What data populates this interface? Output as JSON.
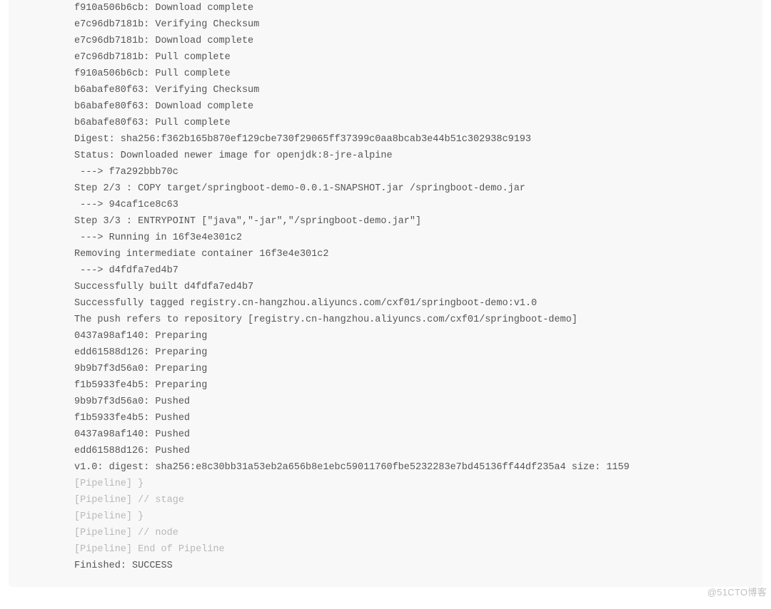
{
  "console": {
    "lines": [
      {
        "text": "f910a506b6cb: Download complete",
        "muted": false
      },
      {
        "text": "e7c96db7181b: Verifying Checksum",
        "muted": false
      },
      {
        "text": "e7c96db7181b: Download complete",
        "muted": false
      },
      {
        "text": "e7c96db7181b: Pull complete",
        "muted": false
      },
      {
        "text": "f910a506b6cb: Pull complete",
        "muted": false
      },
      {
        "text": "b6abafe80f63: Verifying Checksum",
        "muted": false
      },
      {
        "text": "b6abafe80f63: Download complete",
        "muted": false
      },
      {
        "text": "b6abafe80f63: Pull complete",
        "muted": false
      },
      {
        "text": "Digest: sha256:f362b165b870ef129cbe730f29065ff37399c0aa8bcab3e44b51c302938c9193",
        "muted": false
      },
      {
        "text": "Status: Downloaded newer image for openjdk:8-jre-alpine",
        "muted": false
      },
      {
        "text": " ---> f7a292bbb70c",
        "muted": false
      },
      {
        "text": "Step 2/3 : COPY target/springboot-demo-0.0.1-SNAPSHOT.jar /springboot-demo.jar",
        "muted": false
      },
      {
        "text": " ---> 94caf1ce8c63",
        "muted": false
      },
      {
        "text": "Step 3/3 : ENTRYPOINT [\"java\",\"-jar\",\"/springboot-demo.jar\"]",
        "muted": false
      },
      {
        "text": " ---> Running in 16f3e4e301c2",
        "muted": false
      },
      {
        "text": "Removing intermediate container 16f3e4e301c2",
        "muted": false
      },
      {
        "text": " ---> d4fdfa7ed4b7",
        "muted": false
      },
      {
        "text": "Successfully built d4fdfa7ed4b7",
        "muted": false
      },
      {
        "text": "Successfully tagged registry.cn-hangzhou.aliyuncs.com/cxf01/springboot-demo:v1.0",
        "muted": false
      },
      {
        "text": "The push refers to repository [registry.cn-hangzhou.aliyuncs.com/cxf01/springboot-demo]",
        "muted": false
      },
      {
        "text": "0437a98af140: Preparing",
        "muted": false
      },
      {
        "text": "edd61588d126: Preparing",
        "muted": false
      },
      {
        "text": "9b9b7f3d56a0: Preparing",
        "muted": false
      },
      {
        "text": "f1b5933fe4b5: Preparing",
        "muted": false
      },
      {
        "text": "9b9b7f3d56a0: Pushed",
        "muted": false
      },
      {
        "text": "f1b5933fe4b5: Pushed",
        "muted": false
      },
      {
        "text": "0437a98af140: Pushed",
        "muted": false
      },
      {
        "text": "edd61588d126: Pushed",
        "muted": false
      },
      {
        "text": "v1.0: digest: sha256:e8c30bb31a53eb2a656b8e1ebc59011760fbe5232283e7bd45136ff44df235a4 size: 1159",
        "muted": false
      },
      {
        "text": "[Pipeline] }",
        "muted": true
      },
      {
        "text": "[Pipeline] // stage",
        "muted": true
      },
      {
        "text": "[Pipeline] }",
        "muted": true
      },
      {
        "text": "[Pipeline] // node",
        "muted": true
      },
      {
        "text": "[Pipeline] End of Pipeline",
        "muted": true
      },
      {
        "text": "Finished: SUCCESS",
        "muted": false
      }
    ]
  },
  "watermark": "@51CTO博客"
}
